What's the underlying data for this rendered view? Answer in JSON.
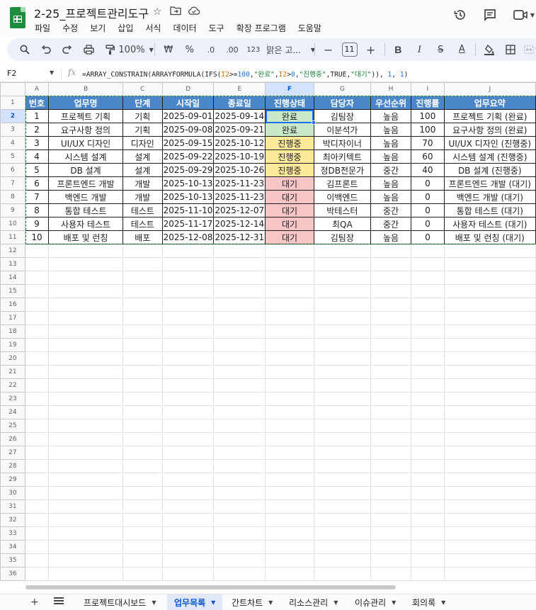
{
  "doc": {
    "title": "2-25_프로젝트관리도구",
    "menu": [
      "파일",
      "수정",
      "보기",
      "삽입",
      "서식",
      "데이터",
      "도구",
      "확장 프로그램",
      "도움말"
    ]
  },
  "toolbar": {
    "zoom": "100%",
    "currency": "₩",
    "percent": "%",
    "dec_dec": ".0",
    "dec_inc": ".00",
    "format_123": "123",
    "font": "맑은 고...",
    "font_size": "11"
  },
  "formula_bar": {
    "cell_ref": "F2",
    "fx": "fx",
    "formula_parts": [
      {
        "t": "=ARRAY_CONSTRAIN(ARRAYFORMULA(IFS(",
        "c": ""
      },
      {
        "t": "I2",
        "c": "f-ref"
      },
      {
        "t": ">=",
        "c": ""
      },
      {
        "t": "100",
        "c": "f-num"
      },
      {
        "t": ",",
        "c": ""
      },
      {
        "t": "\"완료\"",
        "c": "f-str"
      },
      {
        "t": ",",
        "c": ""
      },
      {
        "t": "I2",
        "c": "f-ref"
      },
      {
        "t": ">",
        "c": ""
      },
      {
        "t": "0",
        "c": "f-num"
      },
      {
        "t": ",",
        "c": ""
      },
      {
        "t": "\"진행중\"",
        "c": "f-str"
      },
      {
        "t": ",TRUE,",
        "c": ""
      },
      {
        "t": "\"대기\"",
        "c": "f-str"
      },
      {
        "t": ")), ",
        "c": ""
      },
      {
        "t": "1",
        "c": "f-num"
      },
      {
        "t": ", ",
        "c": ""
      },
      {
        "t": "1",
        "c": "f-num"
      },
      {
        "t": ")",
        "c": ""
      }
    ]
  },
  "sheet": {
    "col_letters": [
      "A",
      "B",
      "C",
      "D",
      "E",
      "F",
      "G",
      "H",
      "I",
      "J"
    ],
    "selected_col": "F",
    "selected_row": 2,
    "headers": [
      "번호",
      "업무명",
      "단계",
      "시작일",
      "종료일",
      "진행상태",
      "담당자",
      "우선순위",
      "진행률",
      "업무요약"
    ],
    "rows": [
      [
        "1",
        "프로젝트 기획",
        "기획",
        "2025-09-01",
        "2025-09-14",
        "완료",
        "김팀장",
        "높음",
        "100",
        "프로젝트 기획 (완료)"
      ],
      [
        "2",
        "요구사항 정의",
        "기획",
        "2025-09-08",
        "2025-09-21",
        "완료",
        "이분석가",
        "높음",
        "100",
        "요구사항 정의 (완료)"
      ],
      [
        "3",
        "UI/UX 디자인",
        "디자인",
        "2025-09-15",
        "2025-10-12",
        "진행중",
        "박디자이너",
        "높음",
        "70",
        "UI/UX 디자인 (진행중)"
      ],
      [
        "4",
        "시스템 설계",
        "설계",
        "2025-09-22",
        "2025-10-19",
        "진행중",
        "최아키텍트",
        "높음",
        "60",
        "시스템 설계 (진행중)"
      ],
      [
        "5",
        "DB 설계",
        "설계",
        "2025-09-29",
        "2025-10-26",
        "진행중",
        "정DB전문가",
        "중간",
        "40",
        "DB 설계 (진행중)"
      ],
      [
        "6",
        "프론트엔드 개발",
        "개발",
        "2025-10-13",
        "2025-11-23",
        "대기",
        "김프론트",
        "높음",
        "0",
        "프론트엔드 개발 (대기)"
      ],
      [
        "7",
        "백엔드 개발",
        "개발",
        "2025-10-13",
        "2025-11-23",
        "대기",
        "이백엔드",
        "높음",
        "0",
        "백엔드 개발 (대기)"
      ],
      [
        "8",
        "통합 테스트",
        "테스트",
        "2025-11-10",
        "2025-12-07",
        "대기",
        "박테스터",
        "중간",
        "0",
        "통합 테스트 (대기)"
      ],
      [
        "9",
        "사용자 테스트",
        "테스트",
        "2025-11-17",
        "2025-12-14",
        "대기",
        "최QA",
        "중간",
        "0",
        "사용자 테스트 (대기)"
      ],
      [
        "10",
        "배포 및 런칭",
        "배포",
        "2025-12-08",
        "2025-12-31",
        "대기",
        "김팀장",
        "높음",
        "0",
        "배포 및 런칭 (대기)"
      ]
    ],
    "row_numbers": [
      "1",
      "2",
      "3",
      "4",
      "5",
      "6",
      "7",
      "8",
      "9",
      "10",
      "11",
      "12",
      "13",
      "14",
      "15",
      "16",
      "17",
      "18",
      "19",
      "20",
      "21",
      "22",
      "23",
      "24",
      "25",
      "26",
      "27",
      "28",
      "29",
      "30",
      "31",
      "32",
      "33",
      "34",
      "35",
      "36"
    ]
  },
  "status_colors": {
    "완료": "#c9e9c9",
    "진행중": "#fde99a",
    "대기": "#f7c5c5"
  },
  "header_color": "#4a86c8",
  "tabs": [
    {
      "label": "프로젝트대시보드",
      "active": false
    },
    {
      "label": "업무목록",
      "active": true
    },
    {
      "label": "간트차트",
      "active": false
    },
    {
      "label": "리소스관리",
      "active": false
    },
    {
      "label": "이슈관리",
      "active": false
    },
    {
      "label": "회의록",
      "active": false
    }
  ]
}
